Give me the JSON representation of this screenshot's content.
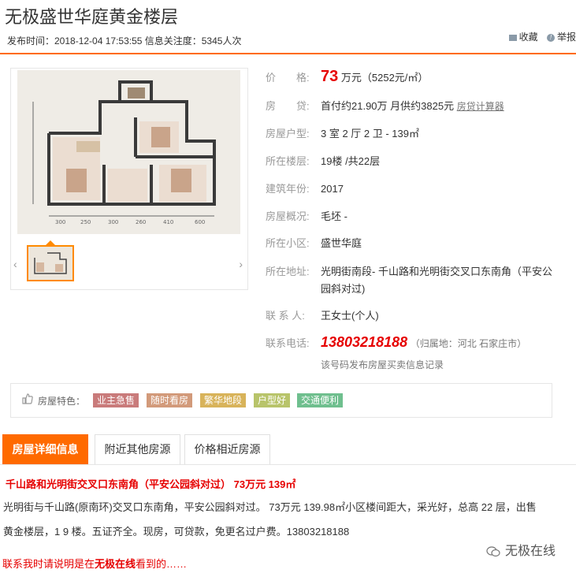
{
  "title": "无极盛世华庭黄金楼层",
  "meta": "发布时间：2018-12-04 17:53:55 信息关注度：5345人次",
  "actions": {
    "favorite": "收藏",
    "report": "举报"
  },
  "gallery": {
    "prev": "‹",
    "next": "›"
  },
  "info": {
    "price_label": "价　　格:",
    "price_value": "73",
    "price_unit": "万元（5252元/㎡）",
    "loan_label": "房　　贷:",
    "loan_value": "首付约21.90万 月供约3825元",
    "loan_link": "房贷计算器",
    "layout_label": "房屋户型:",
    "layout_value": "3 室 2 厅 2 卫 - 139㎡",
    "floor_label": "所在楼层:",
    "floor_value": "19楼 /共22层",
    "year_label": "建筑年份:",
    "year_value": "2017",
    "condition_label": "房屋概况:",
    "condition_value": "毛坯 -",
    "community_label": "所在小区:",
    "community_value": "盛世华庭",
    "address_label": "所在地址:",
    "address_line1": "光明街南段- 千山路和光明街交叉口东南角（平安公",
    "address_line2": "园斜对过)",
    "contact_label": "联 系 人:",
    "contact_value": "王女士(个人)",
    "phone_label": "联系电话:",
    "phone_value": "13803218188",
    "phone_region": "（归属地：河北 石家庄市）",
    "phone_note": "该号码发布房屋买卖信息记录"
  },
  "features": {
    "label": "房屋特色：",
    "tags": [
      {
        "text": "业主急售",
        "color": "#c97b7b"
      },
      {
        "text": "随时看房",
        "color": "#d29a7a"
      },
      {
        "text": "繁华地段",
        "color": "#d8b35a"
      },
      {
        "text": "户型好",
        "color": "#b8c46a"
      },
      {
        "text": "交通便利",
        "color": "#6fbf8e"
      }
    ]
  },
  "tabs": [
    "房屋详细信息",
    "附近其他房源",
    "价格相近房源"
  ],
  "description": {
    "headline": "千山路和光明街交叉口东南角（平安公园斜对过） 73万元 139㎡",
    "line1": "光明街与千山路(原南环)交叉口东南角，平安公园斜对过。 73万元 139.98㎡小区楼间距大，采光好，总高 22 层，出售",
    "line2": "黄金楼层，1 9 楼。五证齐全。现房，可贷款，免更名过户费。13803218188"
  },
  "contact_note": {
    "prefix": "联系我时请说明是在",
    "site": "无极在线",
    "suffix": "看到的……"
  },
  "watermark": "无极在线",
  "colors": {
    "accent": "#ff6a00",
    "price_red": "#e60000"
  }
}
